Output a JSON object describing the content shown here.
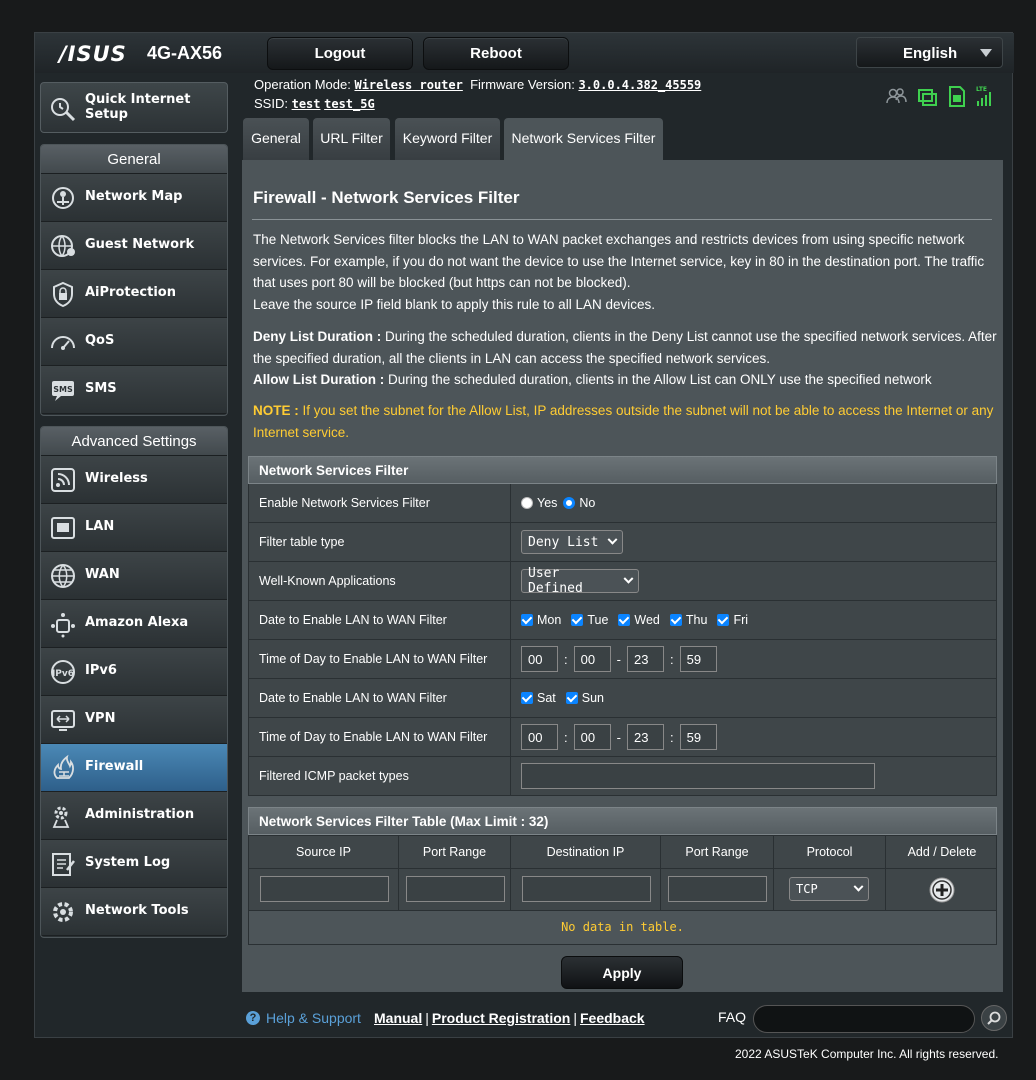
{
  "header": {
    "brand": "/ISUS",
    "model": "4G-AX56",
    "logout_label": "Logout",
    "reboot_label": "Reboot",
    "language": "English"
  },
  "info": {
    "op_mode_label": "Operation Mode:",
    "op_mode_value": "Wireless router",
    "firmware_label": "Firmware Version:",
    "firmware_value": "3.0.0.4.382_45559",
    "ssid_label": "SSID:",
    "ssid_1": "test",
    "ssid_2": "test_5G"
  },
  "sidebar": {
    "quick_setup": "Quick Internet Setup",
    "general_header": "General",
    "general_items": [
      {
        "label": "Network Map",
        "icon": "network-map-icon"
      },
      {
        "label": "Guest Network",
        "icon": "guest-network-icon"
      },
      {
        "label": "AiProtection",
        "icon": "aiprotection-icon"
      },
      {
        "label": "QoS",
        "icon": "qos-icon"
      },
      {
        "label": "SMS",
        "icon": "sms-icon"
      }
    ],
    "advanced_header": "Advanced Settings",
    "advanced_items": [
      {
        "label": "Wireless",
        "icon": "wireless-icon"
      },
      {
        "label": "LAN",
        "icon": "lan-icon"
      },
      {
        "label": "WAN",
        "icon": "wan-icon"
      },
      {
        "label": "Amazon Alexa",
        "icon": "alexa-icon"
      },
      {
        "label": "IPv6",
        "icon": "ipv6-icon"
      },
      {
        "label": "VPN",
        "icon": "vpn-icon"
      },
      {
        "label": "Firewall",
        "icon": "firewall-icon"
      },
      {
        "label": "Administration",
        "icon": "administration-icon"
      },
      {
        "label": "System Log",
        "icon": "system-log-icon"
      },
      {
        "label": "Network Tools",
        "icon": "network-tools-icon"
      }
    ]
  },
  "tabs": [
    "General",
    "URL Filter",
    "Keyword Filter",
    "Network Services Filter"
  ],
  "page": {
    "title": "Firewall - Network Services Filter",
    "desc1": "The Network Services filter blocks the LAN to WAN packet exchanges and restricts devices from using specific network services. For example, if you do not want the device to use the Internet service, key in 80 in the destination port. The traffic that uses port 80 will be blocked (but https can not be blocked).",
    "desc2": "Leave the source IP field blank to apply this rule to all LAN devices.",
    "deny_label": "Deny List Duration :",
    "deny_text": "During the scheduled duration, clients in the Deny List cannot use the specified network services. After the specified duration, all the clients in LAN can access the specified network services.",
    "allow_label": "Allow List Duration :",
    "allow_text": "During the scheduled duration, clients in the Allow List can ONLY use the specified network",
    "note_label": "NOTE :",
    "note_text": "If you set the subnet for the Allow List, IP addresses outside the subnet will not be able to access the Internet or any Internet service."
  },
  "filter_section": {
    "header": "Network Services Filter",
    "enable_label": "Enable Network Services Filter",
    "yes": "Yes",
    "no": "No",
    "table_type_label": "Filter table type",
    "table_type_value": "Deny List",
    "apps_label": "Well-Known Applications",
    "apps_value": "User Defined",
    "weekday_label": "Date to Enable LAN to WAN Filter",
    "weekdays": [
      "Mon",
      "Tue",
      "Wed",
      "Thu",
      "Fri"
    ],
    "weekday_time_label": "Time of Day to Enable LAN to WAN Filter",
    "weekday_time": [
      "00",
      "00",
      "23",
      "59"
    ],
    "weekend_label": "Date to Enable LAN to WAN Filter",
    "weekend": [
      "Sat",
      "Sun"
    ],
    "weekend_time_label": "Time of Day to Enable LAN to WAN Filter",
    "weekend_time": [
      "00",
      "00",
      "23",
      "59"
    ],
    "icmp_label": "Filtered ICMP packet types"
  },
  "rules_table": {
    "header": "Network Services Filter Table (Max Limit : 32)",
    "columns": [
      "Source IP",
      "Port Range",
      "Destination IP",
      "Port Range",
      "Protocol",
      "Add / Delete"
    ],
    "protocol_value": "TCP",
    "empty_text": "No data in table."
  },
  "apply_label": "Apply",
  "footer": {
    "help": "Help & Support",
    "manual": "Manual",
    "registration": "Product Registration",
    "feedback": "Feedback",
    "faq": "FAQ",
    "copyright": "2022 ASUSTeK Computer Inc. All rights reserved."
  }
}
